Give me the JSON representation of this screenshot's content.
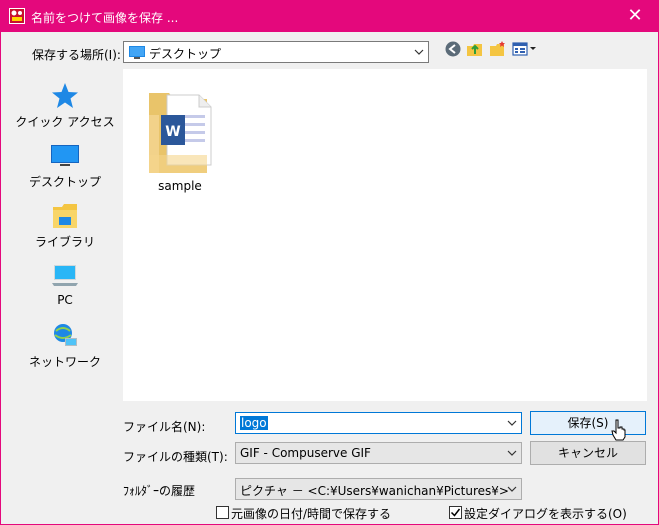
{
  "window": {
    "title": "名前をつけて画像を保存 ...",
    "close_glyph": "✕"
  },
  "location": {
    "label": "保存する場所(I):",
    "value": "デスクトップ"
  },
  "places": [
    {
      "label": "クイック アクセス",
      "icon": "quick-access-star-icon"
    },
    {
      "label": "デスクトップ",
      "icon": "desktop-icon"
    },
    {
      "label": "ライブラリ",
      "icon": "library-icon"
    },
    {
      "label": "PC",
      "icon": "pc-icon"
    },
    {
      "label": "ネットワーク",
      "icon": "network-icon"
    }
  ],
  "files": [
    {
      "name": "sample",
      "icon": "folder-word-icon"
    }
  ],
  "filename": {
    "label": "ファイル名(N):",
    "value": "logo"
  },
  "filetype": {
    "label": "ファイルの種類(T):",
    "value": "GIF - Compuserve GIF"
  },
  "history": {
    "label": "ﾌｫﾙﾀﾞｰの履歴",
    "value": "ピクチャ － <C:¥Users¥wanichan¥Pictures¥>"
  },
  "buttons": {
    "save": "保存(S)",
    "cancel": "キャンセル"
  },
  "options": {
    "keep_date": {
      "label": "元画像の日付/時間で保存する",
      "checked": false
    },
    "show_settings": {
      "label": "設定ダイアログを表示する(O)",
      "checked": true
    }
  },
  "colors": {
    "titlebar": "#e4087c",
    "accent": "#0078d7"
  }
}
